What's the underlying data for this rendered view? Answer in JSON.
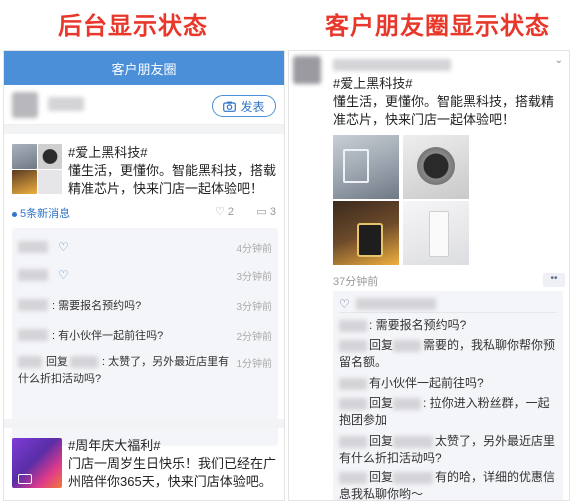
{
  "headings": {
    "left": "后台显示状态",
    "right": "客户朋友圈显示状态"
  },
  "colors": {
    "heading_red": "#e8382b",
    "header_blue": "#4a8fd8",
    "link_blue": "#2f74c8",
    "wechat_link": "#576b95"
  },
  "backend": {
    "header_title": "客户朋友圈",
    "publish_button": "发表",
    "post1": {
      "line1": "#爱上黑科技#",
      "line2": "懂生活，更懂你。智能黑科技，搭载精准芯片，快来门店一起体验吧！",
      "messages": "5条新消息",
      "like_count": "2",
      "comment_count": "3"
    },
    "comments": [
      {
        "text": "",
        "time": "4分钟前",
        "type": "like"
      },
      {
        "text": "",
        "time": "3分钟前",
        "type": "like"
      },
      {
        "text": ": 需要报名预约吗?",
        "time": "3分钟前",
        "type": "comment"
      },
      {
        "text": ": 有小伙伴一起前往吗?",
        "time": "2分钟前",
        "type": "comment"
      },
      {
        "text": "回复",
        "reply": ": 太赞了，另外最近店里有什么折扣活动吗?",
        "time": "1分钟前",
        "type": "reply"
      }
    ],
    "post2": {
      "line1": "#周年庆大福利#",
      "line2": "门店一周岁生日快乐！我们已经在广州陪伴你365天，快来门店体验吧。"
    }
  },
  "moments": {
    "post_line1": "#爱上黑科技#",
    "post_line2": "懂生活，更懂你。智能黑科技，搭载精准芯片，快来门店一起体验吧！",
    "time": "37分钟前",
    "more": "••",
    "comments": [
      {
        "prefix": "",
        "text": ": 需要报名预约吗?"
      },
      {
        "prefix": "回复",
        "text": "需要的，我私聊你帮你预留名额。"
      },
      {
        "prefix": "",
        "text": "有小伙伴一起前往吗?"
      },
      {
        "prefix": "回复",
        "text": ": 拉你进入粉丝群，一起抱团参加"
      },
      {
        "prefix": "回复",
        "text": "太赞了，另外最近店里有什么折扣活动吗?"
      },
      {
        "prefix": "回复",
        "text": "有的哈，详细的优惠信息我私聊你哟～"
      }
    ]
  }
}
